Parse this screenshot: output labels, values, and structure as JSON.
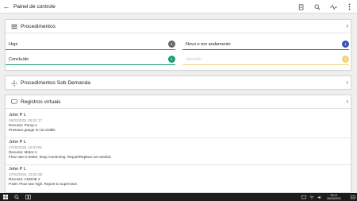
{
  "appbar": {
    "title": "Painel de controle"
  },
  "procedures": {
    "title": "Procedimentos",
    "tiles": [
      {
        "label": "Hoje",
        "count": "1",
        "color": "#6a6a6a"
      },
      {
        "label": "Novo e em andamento",
        "count": "1",
        "color": "#3f51b5"
      },
      {
        "label": "Concluído",
        "count": "1",
        "color": "#1e9e6e"
      },
      {
        "label": "Vencido",
        "count": "1",
        "color": "#f3d37a"
      }
    ]
  },
  "on_demand": {
    "title": "Procedimentos Sob Demanda"
  },
  "records": {
    "title": "Registros virtuais",
    "items": [
      {
        "name": "John P L",
        "date": "18/03/2021 05:02:17",
        "resource": "Recurso: Pump-1",
        "message": "Pressure gauge is not visible"
      },
      {
        "name": "John P L",
        "date": "17/03/2021 10:03:51",
        "resource": "Recurso: Motor-1",
        "message": "Flow rate is better, keep monitoring. Repair/Replace as needed."
      },
      {
        "name": "John P L",
        "date": "17/03/2021 10:02:36",
        "resource": "Recurso: ANONE 2",
        "message": "P100: Flow rate high. Report to supervisor."
      }
    ]
  },
  "taskbar": {
    "time": "08:21",
    "date": "26/03/2021"
  }
}
